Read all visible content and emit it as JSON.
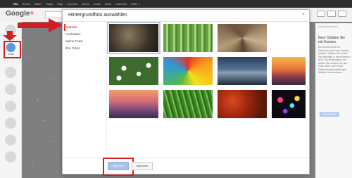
{
  "topnav": {
    "items": [
      "+Du",
      "Suche",
      "Bilder",
      "Maps",
      "Play",
      "YouTube",
      "News",
      "Gmail",
      "Drive",
      "Kalender",
      "Mehr »"
    ],
    "active_index": 0
  },
  "header": {
    "logo_text": "Google",
    "logo_plus": "+"
  },
  "rail": {
    "profile_label": "Profil"
  },
  "right_panel": {
    "title": "Hangout starten",
    "heading": "Neu! Chatten Sie mit Kreisen.",
    "body": "Sie können jetzt mit Personen aus Ihren Kreisen chatten. Wählen Sie selbst Sie ebenfalls in Ihren Kreisen sind. Um festzulegen, wer sieben Sie einfach nur den Chat. Mehr zum Punkt Datenschutzeinstellungen. Weitere Informationen",
    "button": "Chat aktivieren"
  },
  "dialog": {
    "title": "Hintergrundfoto auswählen",
    "close": "×",
    "nav": [
      "Galerie",
      "Hochladen",
      "Meine Fotos",
      "Ihre Fotos"
    ],
    "active_nav": 0,
    "footer": {
      "save": "Speichern",
      "cancel": "Abbrechen"
    }
  },
  "colors": {
    "highlight_red": "#d01e24",
    "accent_red": "#dd4b39",
    "primary_blue": "#a9c2ec"
  }
}
